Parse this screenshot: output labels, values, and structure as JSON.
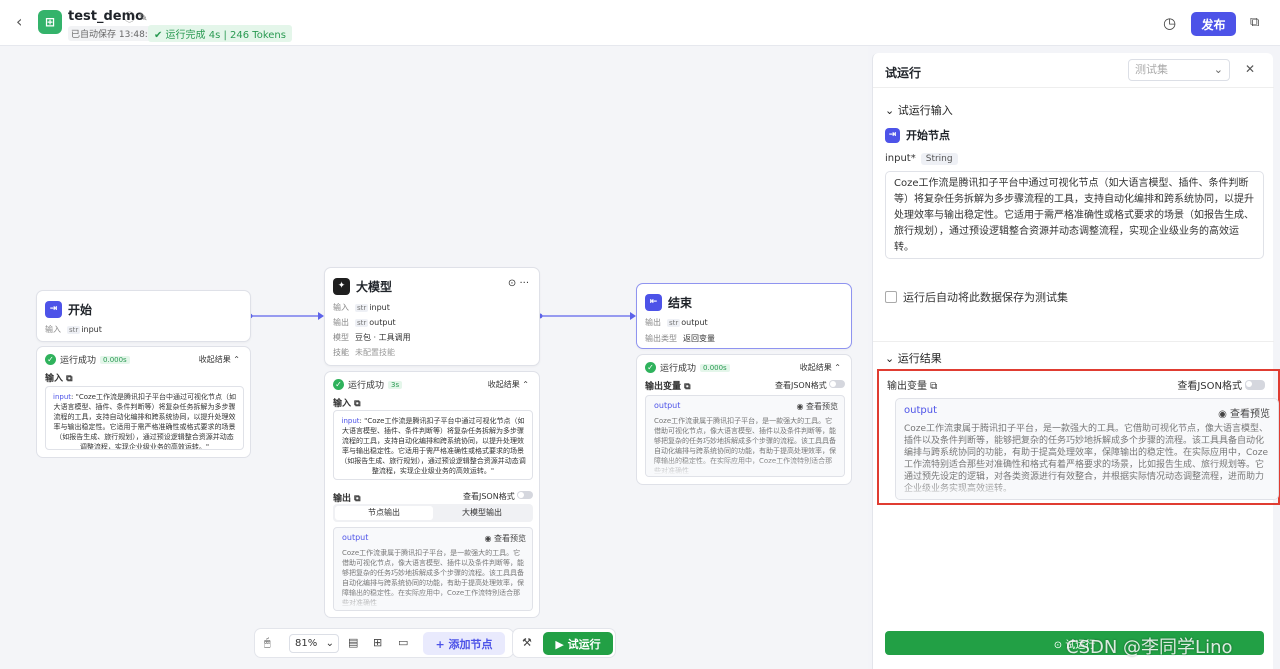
{
  "header": {
    "back_icon": "‹",
    "app_icon": "⊞",
    "app_name": "test_demo",
    "name_icons": "ⓘ ✎",
    "autosave": "已自动保存 13:48:47",
    "run_status": "✔ 运行完成 4s | 246 Tokens",
    "history_icon": "◷",
    "publish_label": "发布",
    "copy_icon": "⧉"
  },
  "nodes": {
    "start": {
      "icon": "⇥",
      "title": "开始",
      "input_label": "输入",
      "input_type": "str",
      "input_name": "input"
    },
    "llm": {
      "icon": "✦",
      "title": "大模型",
      "actions": "⊙ ···",
      "input_label": "输入",
      "input_type": "str",
      "input_name": "input",
      "output_label": "输出",
      "output_type": "str",
      "output_name": "output",
      "model_label": "模型",
      "model_value": "豆包 · 工具调用",
      "skill_label": "技能",
      "skill_value": "未配置技能"
    },
    "end": {
      "icon": "⇤",
      "title": "结束",
      "output_label": "输出",
      "output_type": "str",
      "output_name": "output",
      "type_label": "输出类型",
      "type_value": "返回变量"
    }
  },
  "results": {
    "start": {
      "status": "运行成功",
      "time": "0.000s",
      "collapse": "收起结果 ⌃",
      "input_label": "输入 ⧉",
      "input_key": "input",
      "input_text": ": \"Coze工作流是腾讯扣子平台中通过可视化节点（如大语言模型、插件、条件判断等）将复杂任务拆解为多步骤流程的工具，支持自动化编排和跨系统协同，以提升处理效率与输出稳定性。它适用于需严格准确性或格式要求的场景（如报告生成、旅行规划），通过预设逻辑整合资源并动态调整流程，实现企业级业务的高效运转。\""
    },
    "llm": {
      "status": "运行成功",
      "time": "3s",
      "collapse": "收起结果 ⌃",
      "input_label": "输入 ⧉",
      "input_key": "input",
      "input_text": ": \"Coze工作流是腾讯扣子平台中通过可视化节点（如大语言模型、插件、条件判断等）将复杂任务拆解为多步骤流程的工具，支持自动化编排和跨系统协同，以提升处理效率与输出稳定性。它适用于需严格准确性或格式要求的场景（如报告生成、旅行规划），通过预设逻辑整合资源并动态调整流程，实现企业级业务的高效运转。\"",
      "output_label": "输出 ⧉",
      "json_label": "查看JSON格式",
      "tab_node": "节点输出",
      "tab_model": "大模型输出",
      "out_name": "output",
      "preview": "◉ 查看预览",
      "out_text": "Coze工作流隶属于腾讯扣子平台，是一款强大的工具。它借助可视化节点，像大语言模型、插件以及条件判断等，能够把复杂的任务巧妙地拆解成多个步骤的流程。该工具具备自动化编排与跨系统协同的功能，有助于提高处理效率，保障输出的稳定性。在实际应用中，Coze工作流特别适合那些对准确性"
    },
    "end": {
      "status": "运行成功",
      "time": "0.000s",
      "collapse": "收起结果 ⌃",
      "outvar_label": "输出变量 ⧉",
      "json_label": "查看JSON格式",
      "out_name": "output",
      "preview": "◉ 查看预览",
      "out_text": "Coze工作流隶属于腾讯扣子平台，是一款强大的工具。它借助可视化节点，像大语言模型、插件以及条件判断等，能够把复杂的任务巧妙地拆解成多个步骤的流程。该工具具备自动化编排与跨系统协同的功能，有助于提高处理效率，保障输出的稳定性。在实际应用中，Coze工作流特别适合那些对准确性"
    }
  },
  "toolbar": {
    "mouse_icon": "🖱",
    "zoom": "81%",
    "comment_icon": "▤",
    "grid_icon": "⊞",
    "minimap_icon": "▭",
    "add_node": "+ 添加节点",
    "debug_icon": "⚒",
    "run_label": "▶ 试运行"
  },
  "panel": {
    "title": "试运行",
    "select_placeholder": "测试集",
    "close_icon": "✕",
    "input_section": "⌄ 试运行输入",
    "start_title": "开始节点",
    "input_field_label": "input*",
    "input_field_type": "String",
    "input_value": "Coze工作流是腾讯扣子平台中通过可视化节点（如大语言模型、插件、条件判断等）将复杂任务拆解为多步骤流程的工具，支持自动化编排和跨系统协同，以提升处理效率与输出稳定性。它适用于需严格准确性或格式要求的场景（如报告生成、旅行规划），通过预设逻辑整合资源并动态调整流程，实现企业级业务的高效运转。",
    "save_checkbox": "运行后自动将此数据保存为测试集",
    "result_section": "⌄ 运行结果",
    "outvar_label": "输出变量 ⧉",
    "json_label": "查看JSON格式",
    "out_name": "output",
    "preview": "◉ 查看预览",
    "out_text": "Coze工作流隶属于腾讯扣子平台，是一款强大的工具。它借助可视化节点，像大语言模型、插件以及条件判断等，能够把复杂的任务巧妙地拆解成多个步骤的流程。该工具具备自动化编排与跨系统协同的功能，有助于提高处理效率，保障输出的稳定性。在实际应用中，Coze工作流特别适合那些对准确性和格式有着严格要求的场景，比如报告生成、旅行规划等。它通过预先设定的逻辑，对各类资源进行有效整合，并根据实际情况动态调整流程，进而助力企业级业务实现高效运转。",
    "run_label": "⊙ 试运行"
  },
  "watermark": "CSDN @李同学Lino",
  "colors": {
    "accent": "#4d53e8",
    "success": "#22a045",
    "highlight": "#e03c31"
  }
}
